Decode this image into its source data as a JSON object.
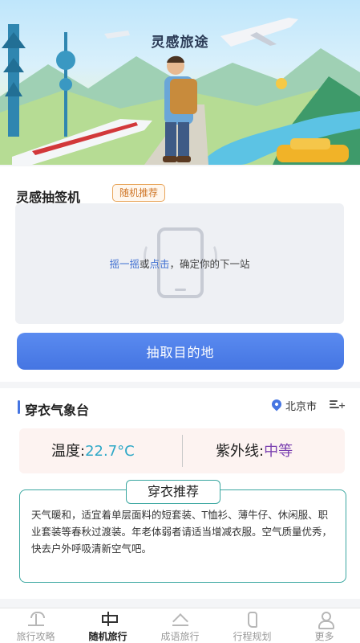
{
  "hero": {
    "title": "灵感旅途"
  },
  "draw_section": {
    "title": "灵感抽签机",
    "badge": "随机推荐",
    "hint_shake": "摇一摇",
    "hint_or": "或",
    "hint_click": "点击",
    "hint_rest": "，确定你的下一站",
    "button_label": "抽取目的地"
  },
  "weather": {
    "title": "穿衣气象台",
    "city": "北京市",
    "temp_label": "温度:",
    "temp_value": "22.7°C",
    "uv_label": "紫外线:",
    "uv_value": "中等",
    "advice_title": "穿衣推荐",
    "advice_text": "天气暖和，适宜着单层面料的短套装、T恤衫、薄牛仔、休闲服、职业套装等春秋过渡装。年老体弱者请适当增减衣服。空气质量优秀，快去户外呼吸清新空气吧。"
  },
  "tabbar": {
    "items": [
      {
        "label": "旅行攻略",
        "icon": "palm-tree-icon"
      },
      {
        "label": "随机旅行",
        "icon": "signpost-icon"
      },
      {
        "label": "成语旅行",
        "icon": "mountain-icon"
      },
      {
        "label": "行程规划",
        "icon": "footprint-icon"
      },
      {
        "label": "更多",
        "icon": "user-icon"
      }
    ],
    "active_index": 1
  },
  "colors": {
    "accent_blue": "#4575e2",
    "badge_orange": "#d0782a",
    "temp_teal": "#2ea8c7",
    "uv_purple": "#7a3fb0",
    "advice_border": "#3aa7a0"
  }
}
